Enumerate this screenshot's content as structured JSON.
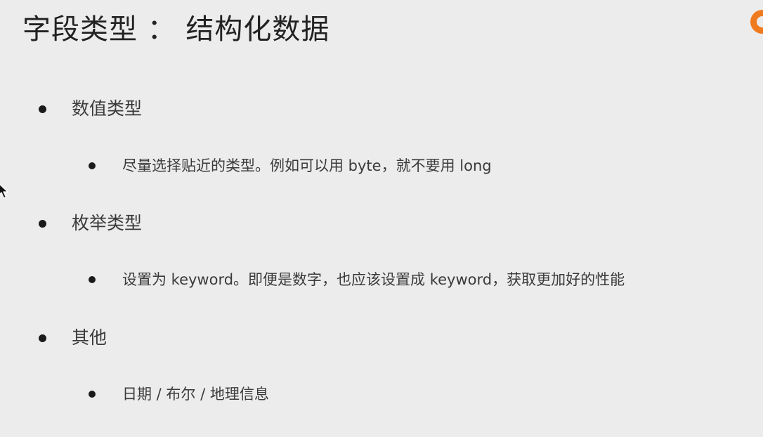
{
  "slide": {
    "title": "字段类型 ： 结构化数据",
    "sections": [
      {
        "label": "数值类型",
        "detail": "尽量选择贴近的类型。例如可以用 byte，就不要用 long"
      },
      {
        "label": "枚举类型",
        "detail": "设置为 keyword。即便是数字，也应该设置成 keyword，获取更加好的性能"
      },
      {
        "label": "其他",
        "detail": "日期 / 布尔 / 地理信息"
      }
    ]
  },
  "icons": {
    "logo": "orange-ring-logo-icon",
    "cursor": "mouse-pointer-icon"
  },
  "colors": {
    "background": "#ececec",
    "text": "#3a3a3a",
    "title": "#222222",
    "logo": "#f07a1e"
  }
}
